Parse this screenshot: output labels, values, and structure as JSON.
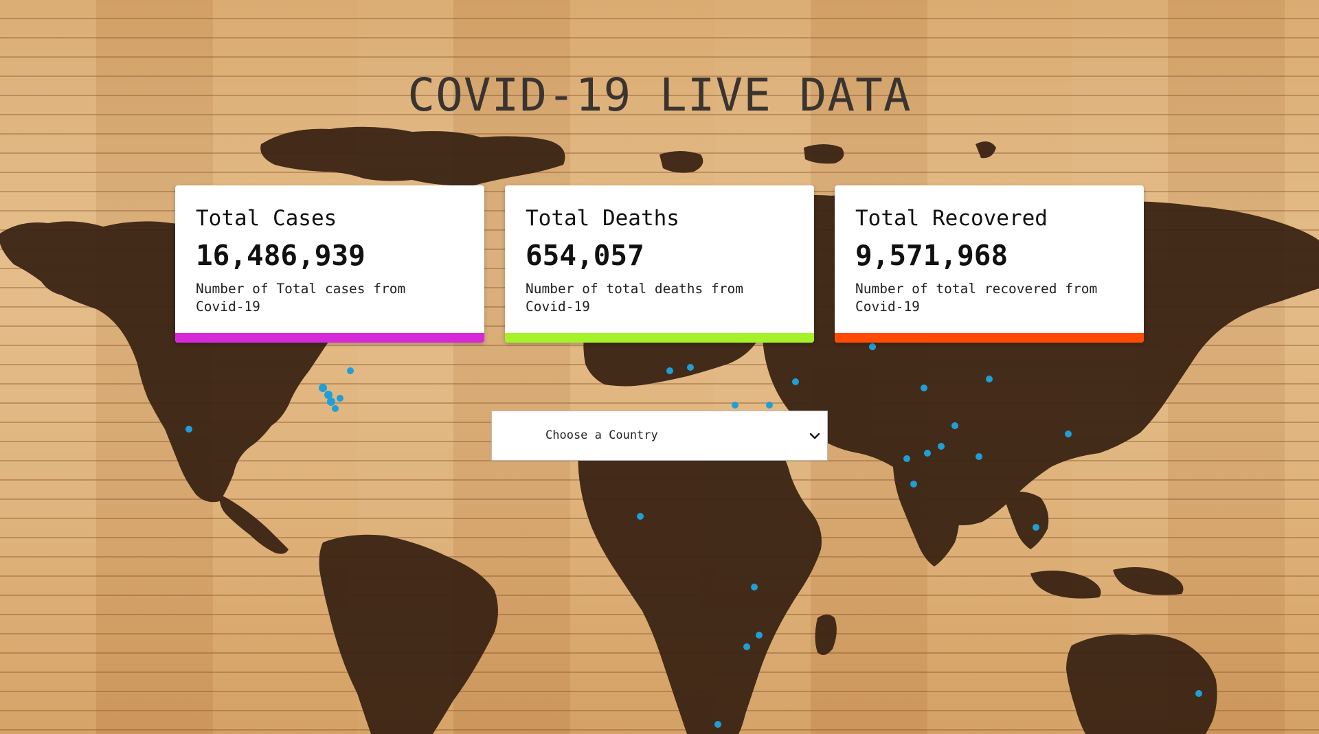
{
  "header": {
    "title": "COVID-19 LIVE DATA"
  },
  "cards": [
    {
      "label": "Total Cases",
      "value": "16,486,939",
      "desc_line1": "Number of Total cases from",
      "desc_line2": "Covid-19",
      "accent": "#d62ad8"
    },
    {
      "label": "Total Deaths",
      "value": "654,057",
      "desc_line1": "Number of total deaths from",
      "desc_line2": "Covid-19",
      "accent": "#a5f22a"
    },
    {
      "label": "Total Recovered",
      "value": "9,571,968",
      "desc_line1": "Number of total recovered from",
      "desc_line2": "Covid-19",
      "accent": "#ff4a04"
    }
  ],
  "country_select": {
    "selected": "Choose a Country",
    "icon": "chevron-down-icon"
  },
  "background": {
    "wood_color": "#dcae76",
    "map_color": "#3b2414",
    "pin_color": "#1f9fd8"
  }
}
